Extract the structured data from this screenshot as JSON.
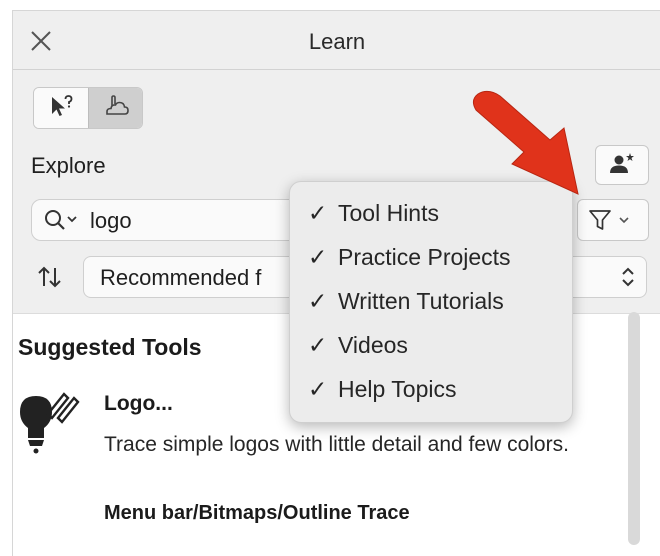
{
  "window": {
    "title": "Learn"
  },
  "explore": {
    "label": "Explore"
  },
  "search": {
    "value": "logo"
  },
  "sort": {
    "selected": "Recommended f"
  },
  "filter_menu": {
    "items": [
      {
        "check": "✓",
        "label": "Tool Hints"
      },
      {
        "check": "✓",
        "label": "Practice Projects"
      },
      {
        "check": "✓",
        "label": "Written Tutorials"
      },
      {
        "check": "✓",
        "label": "Videos"
      },
      {
        "check": "✓",
        "label": "Help Topics"
      }
    ]
  },
  "content": {
    "section_title": "Suggested Tools",
    "tool": {
      "name": "Logo...",
      "description": "Trace simple logos with little detail and few colors.",
      "path": "Menu bar/Bitmaps/Outline Trace"
    }
  },
  "colors": {
    "annotation_arrow": "#e0331b",
    "panel_background": "#efefef",
    "toggle_selected": "#cfcfcf"
  },
  "icons": {
    "close": "close-icon",
    "hint_mode": "pointer-help-icon",
    "explore_mode": "hand-cloud-icon",
    "user": "user-star-icon",
    "search": "search-icon",
    "filter": "funnel-icon",
    "sort": "sort-arrows-icon",
    "tool": "bulb-trace-icon"
  }
}
